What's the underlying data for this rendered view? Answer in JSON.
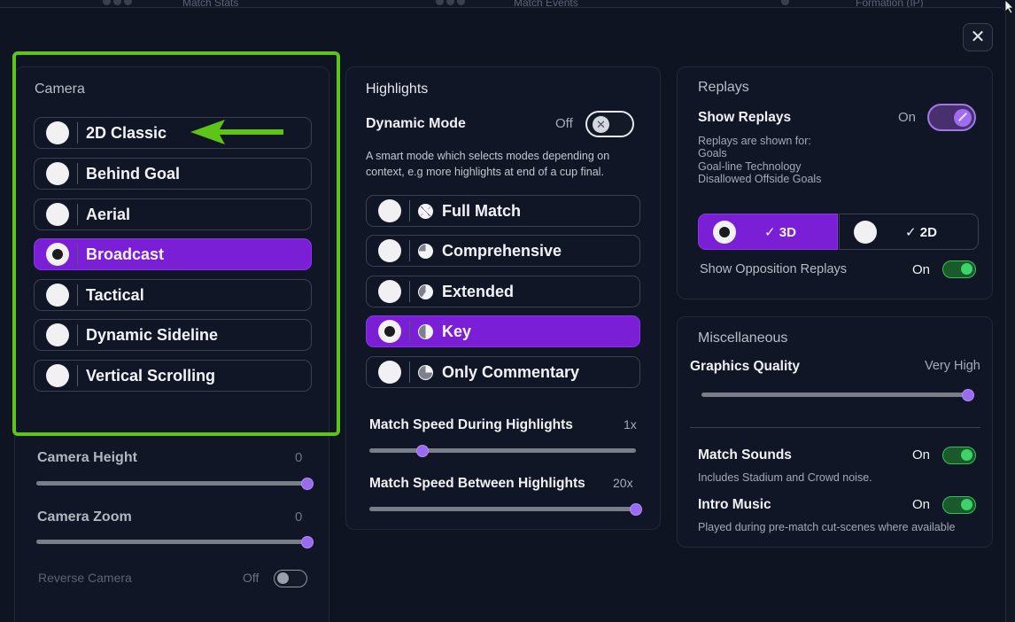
{
  "background": {
    "tab1": "Match Stats",
    "tab2": "Match Events",
    "tab3": "Formation (IP)"
  },
  "close_label": "✕",
  "camera": {
    "title": "Camera",
    "options": [
      {
        "label": "2D Classic",
        "selected": false
      },
      {
        "label": "Behind Goal",
        "selected": false
      },
      {
        "label": "Aerial",
        "selected": false
      },
      {
        "label": "Broadcast",
        "selected": true
      },
      {
        "label": "Tactical",
        "selected": false
      },
      {
        "label": "Dynamic Sideline",
        "selected": false
      },
      {
        "label": "Vertical Scrolling",
        "selected": false
      }
    ],
    "height_label": "Camera Height",
    "height_value": "0",
    "height_level": 1.0,
    "zoom_label": "Camera Zoom",
    "zoom_value": "0",
    "zoom_level": 1.0,
    "reverse_label": "Reverse Camera",
    "reverse_value": "Off"
  },
  "highlights": {
    "title": "Highlights",
    "dynamic_mode_label": "Dynamic Mode",
    "dynamic_mode_value": "Off",
    "description_line1": "A smart mode which selects modes depending on",
    "description_line2": "context, e.g more highlights at end of a cup final.",
    "options": [
      {
        "label": "Full Match",
        "selected": false,
        "fill": 1.0
      },
      {
        "label": "Comprehensive",
        "selected": false,
        "fill": 0.75
      },
      {
        "label": "Extended",
        "selected": false,
        "fill": 0.6
      },
      {
        "label": "Key",
        "selected": true,
        "fill": 0.5
      },
      {
        "label": "Only Commentary",
        "selected": false,
        "fill": 0.25
      }
    ],
    "speed_during_label": "Match Speed During Highlights",
    "speed_during_value": "1x",
    "speed_during_level": 0.2,
    "speed_between_label": "Match Speed Between Highlights",
    "speed_between_value": "20x",
    "speed_between_level": 1.0
  },
  "replays": {
    "title": "Replays",
    "show_label": "Show Replays",
    "show_value": "On",
    "shown_for_line1": "Replays are shown for:",
    "shown_for_line2": "Goals",
    "shown_for_line3": "Goal-line Technology",
    "shown_for_line4": "Disallowed Offside Goals",
    "mode_3d": "✓ 3D",
    "mode_2d": "✓ 2D",
    "opposition_label": "Show Opposition Replays",
    "opposition_value": "On"
  },
  "misc": {
    "title": "Miscellaneous",
    "graphics_label": "Graphics Quality",
    "graphics_value": "Very High",
    "graphics_level": 1.0,
    "sounds_label": "Match Sounds",
    "sounds_value": "On",
    "sounds_desc": "Includes Stadium and Crowd noise.",
    "intro_label": "Intro Music",
    "intro_value": "On",
    "intro_desc": "Played during pre-match cut-scenes where available"
  },
  "colors": {
    "accent": "#7a1fd6",
    "highlight_box": "#5fc418",
    "toggle_on": "#3ed26a"
  }
}
